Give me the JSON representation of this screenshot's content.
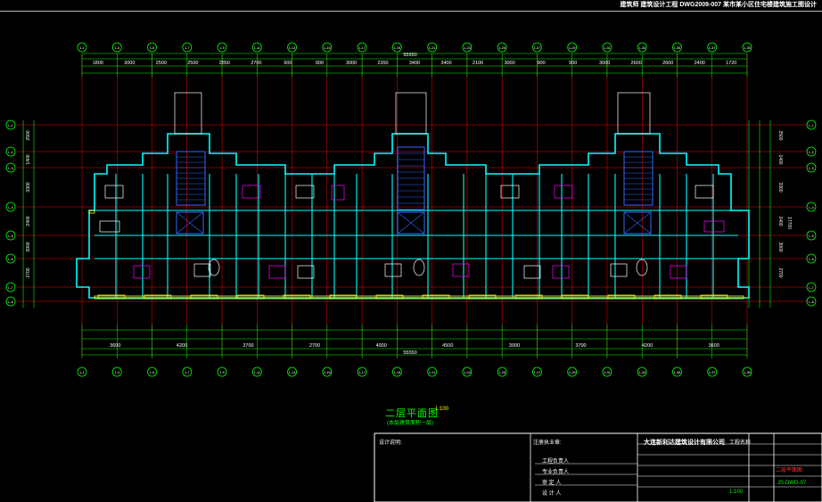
{
  "header": {
    "info": "建筑师   建筑设计工程 DWG2009-007   某市某小区住宅楼建筑施工图设计"
  },
  "plan": {
    "title": "二层平面图",
    "scale": "1:100",
    "subtitle": "(本层建筑面积一层)",
    "overall_dim": "55550"
  },
  "dims": {
    "top_outer": [
      "1800",
      "3000",
      "2500",
      "2500",
      "2850",
      "2700",
      "900",
      "900",
      "3000",
      "2350",
      "3400",
      "3400",
      "2100",
      "3000",
      "900",
      "900",
      "3000",
      "2600",
      "2600",
      "2400",
      "1720"
    ],
    "bottom_outer": [
      "3600",
      "4200",
      "3700",
      "2700",
      "4000",
      "4500",
      "3000",
      "3700",
      "4200",
      "3600"
    ],
    "right": [
      "2500",
      "1400",
      "3300",
      "2400",
      "3000",
      "2700"
    ],
    "right_total": "17700"
  },
  "axes": {
    "top": [
      "1-1",
      "1-3",
      "1-5",
      "1-7",
      "1-9",
      "1-11",
      "1-13",
      "1-15",
      "1-17",
      "1-19",
      "1-21",
      "1-23",
      "1-25",
      "1-27",
      "1-29",
      "1-31",
      "1-33",
      "1-35",
      "1-37",
      "1-39"
    ],
    "left": [
      "L-1",
      "L-2",
      "L-3",
      "L-4",
      "L-5",
      "L-6",
      "L-7",
      "L-8"
    ]
  },
  "title_block": {
    "company": "大连新利达建筑设计有限公司",
    "note_label": "设计说明:",
    "sign_label": "注册执业章:",
    "roles": [
      "工程负责人",
      "专业负责人",
      "审 定 人",
      "设 计 人"
    ],
    "project": "工程名称",
    "drawing_name": "二层平面图",
    "drawing_no": "JS-DWG-07",
    "scale": "1:100"
  },
  "colors": {
    "background": "#000000",
    "wall": "#00ffff",
    "axis": "#ff0000",
    "dimension": "#00ff00",
    "text": "#ffffff",
    "window": "#ffff00",
    "furniture": "#ff00ff"
  }
}
